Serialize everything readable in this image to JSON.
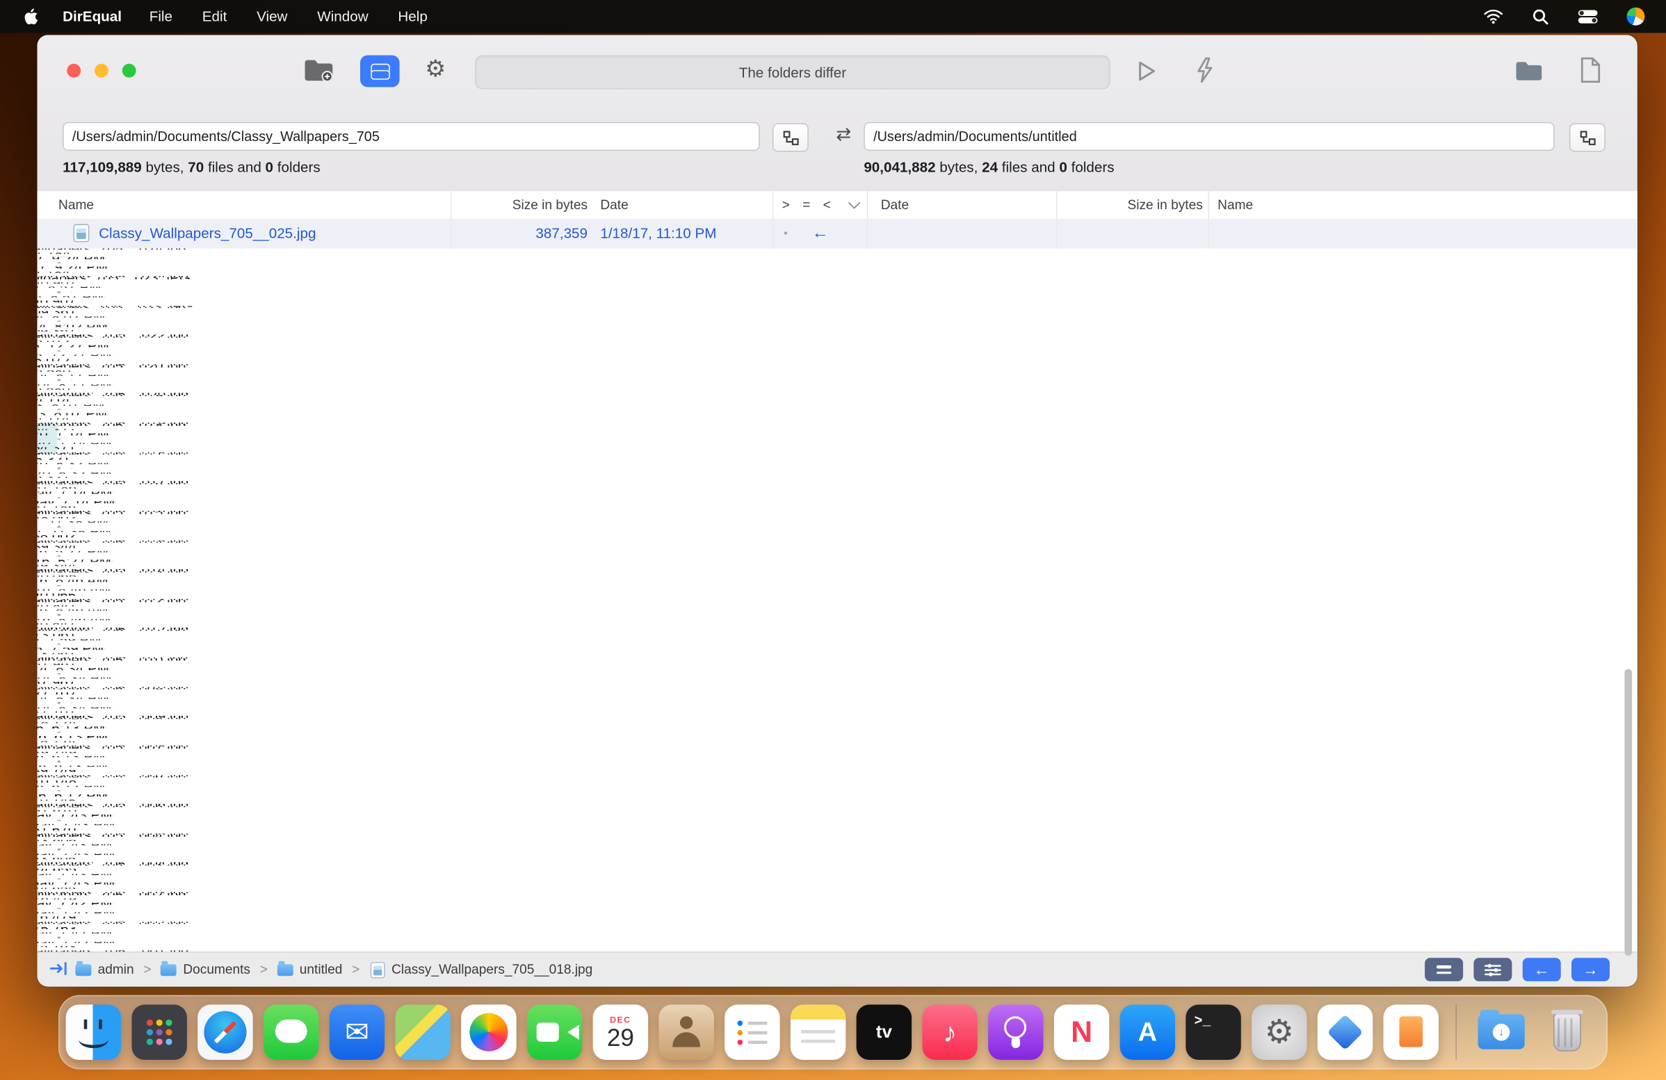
{
  "colors": {
    "accent_blue": "#3d7bfd",
    "equal_green": "#1fb141",
    "diff_blue": "#2456d4",
    "selection_teal": "#d9edef",
    "wallpaper_orange": "#e88a28"
  },
  "menu_bar": {
    "app_name": "DirEqual",
    "menus": [
      "File",
      "Edit",
      "View",
      "Window",
      "Help"
    ],
    "status_icons": [
      "wifi-icon",
      "search-icon",
      "control-center-icon",
      "clock-menu-icon"
    ]
  },
  "window": {
    "toolbar": {
      "status_text": "The folders differ",
      "icons": [
        "folders-icon",
        "compare-view-icon",
        "gear-icon",
        "play-icon",
        "lightning-icon",
        "folder-icon",
        "document-icon"
      ]
    },
    "left_panel": {
      "path": "/Users/admin/Documents/Classy_Wallpapers_705",
      "stats": {
        "bytes": "117,109,889",
        "bytes_label": " bytes, ",
        "files": "70",
        "files_label": " files and ",
        "folders": "0",
        "folders_label": " folders"
      }
    },
    "right_panel": {
      "path": "/Users/admin/Documents/untitled",
      "stats": {
        "bytes": "90,041,882",
        "bytes_label": " bytes, ",
        "files": "24",
        "files_label": " files and ",
        "folders": "0",
        "folders_label": " folders"
      }
    },
    "table": {
      "headers": {
        "name_left": "Name",
        "size_left": "Size in bytes",
        "date_left": "Date",
        "greater": ">",
        "equal": "=",
        "less": "<",
        "date_right": "Date",
        "size_right": "Size in bytes",
        "name_right": "Name"
      },
      "rows": [
        {
          "name": "Classy_Wallpapers_705__025.jpg",
          "size": "387,359",
          "date": "1/18/17, 11:10 PM",
          "status": "left_only"
        },
        {
          "name": "Classy_Wallpapers_705__024.jpg",
          "size": "391,784",
          "date": "1/22/17, 9:24 PM",
          "status": "equal"
        },
        {
          "name": "Classy_Wallpapers_705__023.JPG",
          "size": "3,040,907",
          "date": "2/4/14, 8:51 PM",
          "status": "equal"
        },
        {
          "name": "Classy_Wallpapers_705__022.jpg",
          "size": "4,109,361",
          "date": "1/21/14, 8:02 PM",
          "status": "equal"
        },
        {
          "name": "Classy_Wallpapers_705__021.jpg",
          "size": "485,072",
          "date": "9/18/15, 12:27 PM",
          "status": "equal"
        },
        {
          "name": "Classy_Wallpapers_705__020.jpg",
          "size": "476,580",
          "date": "12/15/14, 8:17 PM",
          "status": "equal"
        },
        {
          "name": "Classy_Wallpapers_705__019.jpg",
          "size": "384,114",
          "date": "11/3/13, 8:07 PM",
          "status": "equal"
        },
        {
          "name": "Classy_Wallpapers_705__018.jpg",
          "size": "3,464,371",
          "date": "12/24/20, 7:14 PM",
          "status": "equal",
          "selected": true
        },
        {
          "name": "Classy_Wallpapers_705__017.jpg",
          "size": "765,321",
          "date": "12/25/20, 8:32 PM",
          "status": "equal"
        },
        {
          "name": "Classy_Wallpapers_705__016.jpg",
          "size": "2,267,186",
          "date": "Yesterday, 7:14 PM",
          "status": "equal"
        },
        {
          "name": "Classy_Wallpapers_705__015.jpg",
          "size": "5,338,002",
          "date": "1/18/17, 11:38 PM",
          "status": "equal"
        },
        {
          "name": "Classy_Wallpapers_705__014.jpg",
          "size": "4,739,344",
          "date": "11/20/16, 5:27 PM",
          "status": "equal"
        },
        {
          "name": "Classy_Wallpapers_705__013.jpg",
          "size": "3,540,065",
          "date": "11/23/16, 8:46 AM",
          "status": "equal"
        },
        {
          "name": "Classy_Wallpapers_705__012.jpg",
          "size": "3,740,847",
          "date": "11/23/16, 8:46 AM",
          "status": "equal"
        },
        {
          "name": "Classy_Wallpapers_705__011.jpg",
          "size": "6,513,061",
          "date": "1/6/15, 7:59 PM",
          "status": "equal"
        },
        {
          "name": "Classy_Wallpapers_705__010.jpg",
          "size": "3,367,967",
          "date": "12/20/14, 8:34 PM",
          "status": "equal"
        },
        {
          "name": "Classy_Wallpapers_705__009.jpg",
          "size": "2,937,107",
          "date": "12/20/14, 8:34 PM",
          "status": "equal"
        },
        {
          "name": "Classy_Wallpapers_705__008.jpg",
          "size": "7,578,724",
          "date": "5/29/16, 6:13 PM",
          "status": "equal"
        },
        {
          "name": "Classy_Wallpapers_705__007.jpg",
          "size": "5,939,749",
          "date": "5/29/16, 6:13 PM",
          "status": "equal"
        },
        {
          "name": "Classy_Wallpapers_705__006.jpg",
          "size": "6,210,148",
          "date": "5/29/16, 6:12 PM",
          "status": "equal"
        },
        {
          "name": "Classy_Wallpapers_705__005.jpg",
          "size": "3,951,670",
          "date": "Yesterday, 7:43 PM",
          "status": "equal"
        },
        {
          "name": "Classy_Wallpapers_705__004.jpg",
          "size": "5,043,605",
          "date": "Yesterday, 7:43 PM",
          "status": "equal"
        },
        {
          "name": "Classy_Wallpapers_705__003.jpg",
          "size": "4,124,655",
          "date": "Yesterday, 7:43 PM",
          "status": "equal"
        },
        {
          "name": "Classy_Wallpapers_705__002.jpg",
          "size": "6,216,479",
          "date": "Yesterday, 7:42 PM",
          "status": "equal"
        },
        {
          "name": "Classy_Wallpapers_705__001.jpg",
          "size": "5,415,763",
          "date": "Yesterday, 7:42 PM",
          "status": "equal"
        }
      ]
    },
    "status_bar": {
      "breadcrumbs": [
        "admin",
        "Documents",
        "untitled",
        "Classy_Wallpapers_705__018.jpg"
      ],
      "separator": ">"
    }
  },
  "dock": {
    "items": [
      "finder",
      "launchpad",
      "safari",
      "messages",
      "mail",
      "maps",
      "photos",
      "facetime",
      "calendar",
      "contacts",
      "reminders",
      "notes",
      "tv",
      "music",
      "podcasts",
      "news",
      "app-store",
      "terminal",
      "system-settings",
      "direqual",
      "pages",
      "downloads",
      "trash"
    ],
    "calendar_month": "DEC",
    "calendar_day": "29",
    "tv_label": "tv",
    "mail_glyph": "✉",
    "music_glyph": "♪",
    "news_label": "N",
    "app_store_label": "A",
    "terminal_label": ">_",
    "settings_glyph": "⚙",
    "downloads_glyph": "↓"
  },
  "glyphs": {
    "swap": "⇄",
    "gear": "⚙",
    "play": "▷",
    "arrow_left": "←",
    "nav_left": "←",
    "nav_right": "→"
  }
}
